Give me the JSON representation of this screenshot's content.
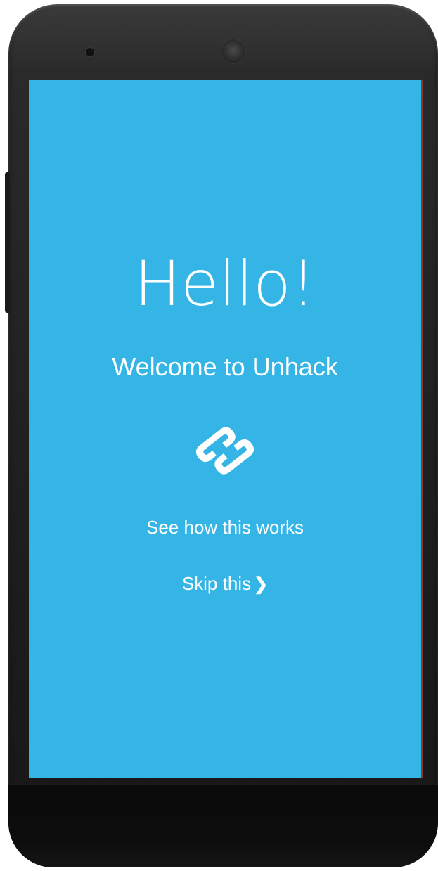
{
  "welcome": {
    "greeting": "Hello!",
    "subtitle": "Welcome to Unhack",
    "logo_icon": "unhack-link-logo-icon",
    "how_it_works_link": "See how this works",
    "skip_link": "Skip this",
    "skip_chevron": "❯"
  },
  "colors": {
    "screen_background": "#35b5e5",
    "text": "#ffffff",
    "device_body": "#1e1e1e"
  }
}
